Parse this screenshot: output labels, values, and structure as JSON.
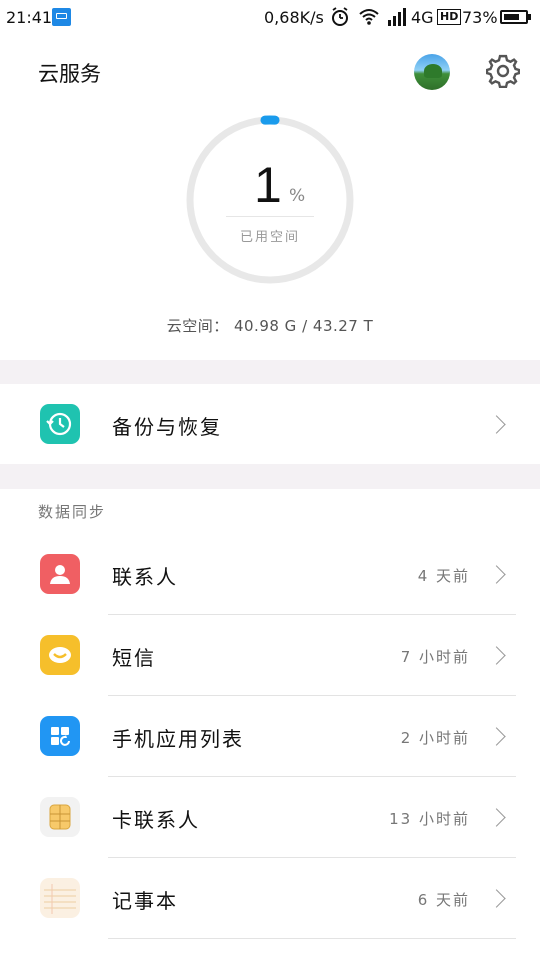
{
  "status_bar": {
    "time": "21:41",
    "speed": "0,68K/s",
    "network": "4G",
    "hd": "HD",
    "battery_text": "73%",
    "battery_level": 0.73
  },
  "header": {
    "title": "云服务"
  },
  "storage": {
    "percent": "1",
    "percent_sign": "%",
    "used_label": "已用空间",
    "info": "云空间： 40.98 G / 43.27 T",
    "used_fraction": 0.01,
    "ring_accent_color": "#1a9bec",
    "ring_track_color": "#e8e8e8"
  },
  "backup": {
    "label": "备份与恢复",
    "icon_color": "#1fc3b0"
  },
  "sync": {
    "section_title": "数据同步",
    "items": [
      {
        "label": "联系人",
        "time": "4 天前",
        "icon": "contact-icon",
        "color": "#f05f63"
      },
      {
        "label": "短信",
        "time": "7 小时前",
        "icon": "message-icon",
        "color": "#f6bf2b"
      },
      {
        "label": "手机应用列表",
        "time": "2 小时前",
        "icon": "app-list-icon",
        "color": "#2196f3"
      },
      {
        "label": "卡联系人",
        "time": "13 小时前",
        "icon": "sim-card-icon",
        "color": "#f2f2f2"
      },
      {
        "label": "记事本",
        "time": "6 天前",
        "icon": "notepad-icon",
        "color": "#fbf0e2"
      }
    ]
  }
}
